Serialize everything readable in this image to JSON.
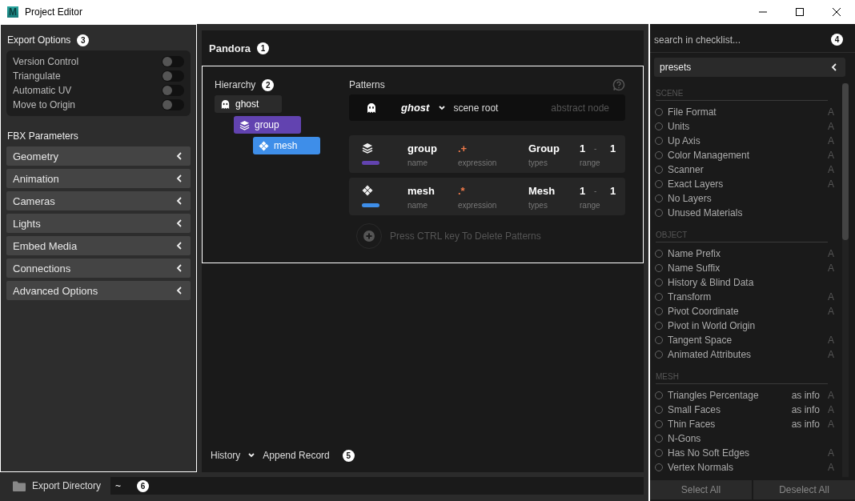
{
  "window": {
    "app_icon_letter": "M",
    "title": "Project Editor"
  },
  "export_options": {
    "title": "Export Options",
    "badge": "3",
    "toggles": [
      {
        "label": "Version Control",
        "on": false
      },
      {
        "label": "Triangulate",
        "on": false
      },
      {
        "label": "Automatic UV",
        "on": false
      },
      {
        "label": "Move to Origin",
        "on": false
      }
    ]
  },
  "fbx_parameters": {
    "title": "FBX Parameters",
    "sections": [
      {
        "label": "Geometry",
        "expanded": false
      },
      {
        "label": "Animation",
        "expanded": false
      },
      {
        "label": "Cameras",
        "expanded": false
      },
      {
        "label": "Lights",
        "expanded": false
      },
      {
        "label": "Embed Media",
        "expanded": false
      },
      {
        "label": "Connections",
        "expanded": false
      },
      {
        "label": "Advanced Options",
        "expanded": false
      }
    ]
  },
  "project": {
    "title": "Pandora",
    "badge": "1"
  },
  "hierarchy": {
    "title": "Hierarchy",
    "badge": "2",
    "nodes": [
      {
        "label": "ghost",
        "kind": "ghost",
        "color": "#2b2b2b",
        "children": [
          {
            "label": "group",
            "kind": "layers",
            "color": "#6243b0",
            "children": [
              {
                "label": "mesh",
                "kind": "mesh",
                "color": "#3e8ee9"
              }
            ]
          }
        ]
      }
    ]
  },
  "patterns": {
    "title": "Patterns",
    "root": {
      "name": "ghost",
      "label": "scene root",
      "hint": "abstract node"
    },
    "rows": [
      {
        "kind": "layers",
        "color": "#6243b0",
        "name": "group",
        "expression": ".+",
        "type": "Group",
        "range_min": "1",
        "range_sep": "-",
        "range_max": "1",
        "name_caption": "name",
        "expression_caption": "expression",
        "types_caption": "types",
        "range_caption": "range"
      },
      {
        "kind": "mesh",
        "color": "#3e8ee9",
        "name": "mesh",
        "expression": ".*",
        "type": "Mesh",
        "range_min": "1",
        "range_sep": "-",
        "range_max": "1",
        "name_caption": "name",
        "expression_caption": "expression",
        "types_caption": "types",
        "range_caption": "range"
      }
    ],
    "add_hint": "Press CTRL key To Delete Patterns"
  },
  "history": {
    "label": "History",
    "action": "Append Record",
    "badge": "5"
  },
  "export_directory": {
    "label": "Export Directory",
    "value": "~",
    "badge": "6"
  },
  "checklist": {
    "search_placeholder": "search in checklist...",
    "badge": "4",
    "presets": {
      "label": "presets",
      "expanded": false
    },
    "groups": [
      {
        "title": "SCENE",
        "items": [
          {
            "label": "File Format",
            "checked": false,
            "flag": "A"
          },
          {
            "label": "Units",
            "checked": false,
            "flag": "A"
          },
          {
            "label": "Up Axis",
            "checked": false,
            "flag": "A"
          },
          {
            "label": "Color Management",
            "checked": false,
            "flag": "A"
          },
          {
            "label": "Scanner",
            "checked": false,
            "flag": "A"
          },
          {
            "label": "Exact Layers",
            "checked": false,
            "flag": "A"
          },
          {
            "label": "No Layers",
            "checked": false
          },
          {
            "label": "Unused Materials",
            "checked": false
          }
        ]
      },
      {
        "title": "OBJECT",
        "items": [
          {
            "label": "Name Prefix",
            "checked": false,
            "flag": "A"
          },
          {
            "label": "Name Suffix",
            "checked": false,
            "flag": "A"
          },
          {
            "label": "History & Blind Data",
            "checked": false
          },
          {
            "label": "Transform",
            "checked": false,
            "flag": "A"
          },
          {
            "label": "Pivot Coordinate",
            "checked": false,
            "flag": "A"
          },
          {
            "label": "Pivot in World Origin",
            "checked": false
          },
          {
            "label": "Tangent Space",
            "checked": false,
            "flag": "A"
          },
          {
            "label": "Animated Attributes",
            "checked": false,
            "flag": "A"
          }
        ]
      },
      {
        "title": "MESH",
        "items": [
          {
            "label": "Triangles Percentage",
            "checked": false,
            "note": "as info",
            "flag": "A"
          },
          {
            "label": "Small Faces",
            "checked": false,
            "note": "as info",
            "flag": "A"
          },
          {
            "label": "Thin Faces",
            "checked": false,
            "note": "as info",
            "flag": "A"
          },
          {
            "label": "N-Gons",
            "checked": false
          },
          {
            "label": "Has No Soft Edges",
            "checked": false,
            "flag": "A"
          },
          {
            "label": "Vertex Normals",
            "checked": false,
            "flag": "A"
          }
        ]
      }
    ]
  },
  "buttons": [
    {
      "label": "Select All"
    },
    {
      "label": "Deselect All"
    }
  ]
}
